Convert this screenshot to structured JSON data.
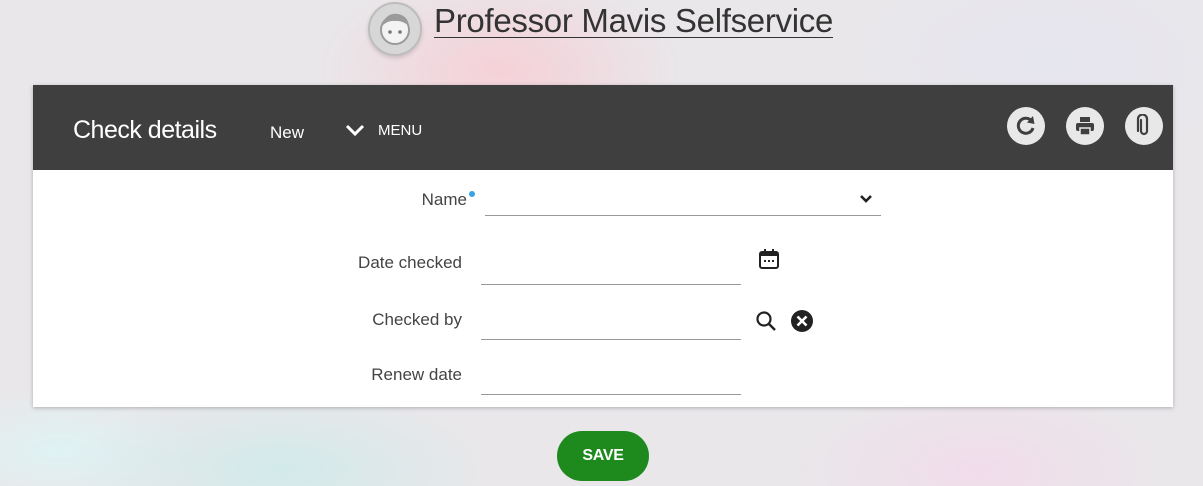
{
  "header": {
    "title": "Professor Mavis Selfservice"
  },
  "card": {
    "title": "Check details",
    "status": "New",
    "menu_label": "MENU",
    "toolbar": {
      "refresh_icon": "refresh-icon",
      "print_icon": "print-icon",
      "attach_icon": "paperclip-icon"
    }
  },
  "form": {
    "name": {
      "label": "Name",
      "required": true,
      "value": ""
    },
    "date_checked": {
      "label": "Date checked",
      "value": ""
    },
    "checked_by": {
      "label": "Checked by",
      "value": ""
    },
    "renew_date": {
      "label": "Renew date",
      "value": ""
    }
  },
  "actions": {
    "save_label": "SAVE"
  },
  "colors": {
    "bar": "#3f3f3f",
    "save": "#1e8a1e",
    "required_dot": "#3aa3e3"
  }
}
